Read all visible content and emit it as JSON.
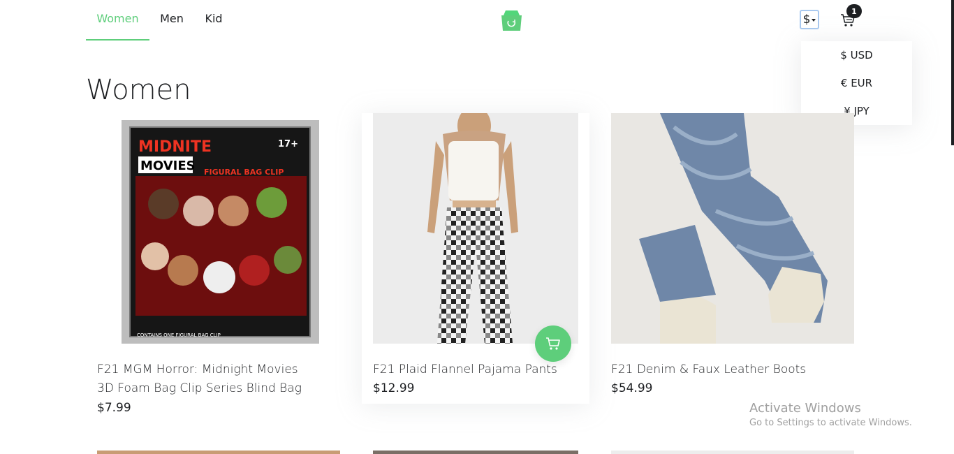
{
  "nav": {
    "items": [
      {
        "label": "Women",
        "active": true
      },
      {
        "label": "Men",
        "active": false
      },
      {
        "label": "Kid",
        "active": false
      }
    ]
  },
  "header": {
    "currency_symbol": "$",
    "cart_count": "1"
  },
  "currency_dropdown": {
    "options": [
      "$ USD",
      "€ EUR",
      "¥ JPY"
    ]
  },
  "page": {
    "title": "Women"
  },
  "products": [
    {
      "title": "F21 MGM Horror: Midnight Movies 3D Foam Bag Clip Series Blind Bag",
      "price": "$7.99",
      "image_icon": "blind-bag-image"
    },
    {
      "title": "F21 Plaid Flannel Pajama Pants",
      "price": "$12.99",
      "image_icon": "pajama-pants-image"
    },
    {
      "title": "F21 Denim & Faux Leather Boots",
      "price": "$54.99",
      "image_icon": "denim-boots-image"
    }
  ],
  "watermark": {
    "line1": "Activate Windows",
    "line2": "Go to Settings to activate Windows."
  },
  "colors": {
    "accent": "#5ece7b",
    "text": "#1d1f22"
  }
}
